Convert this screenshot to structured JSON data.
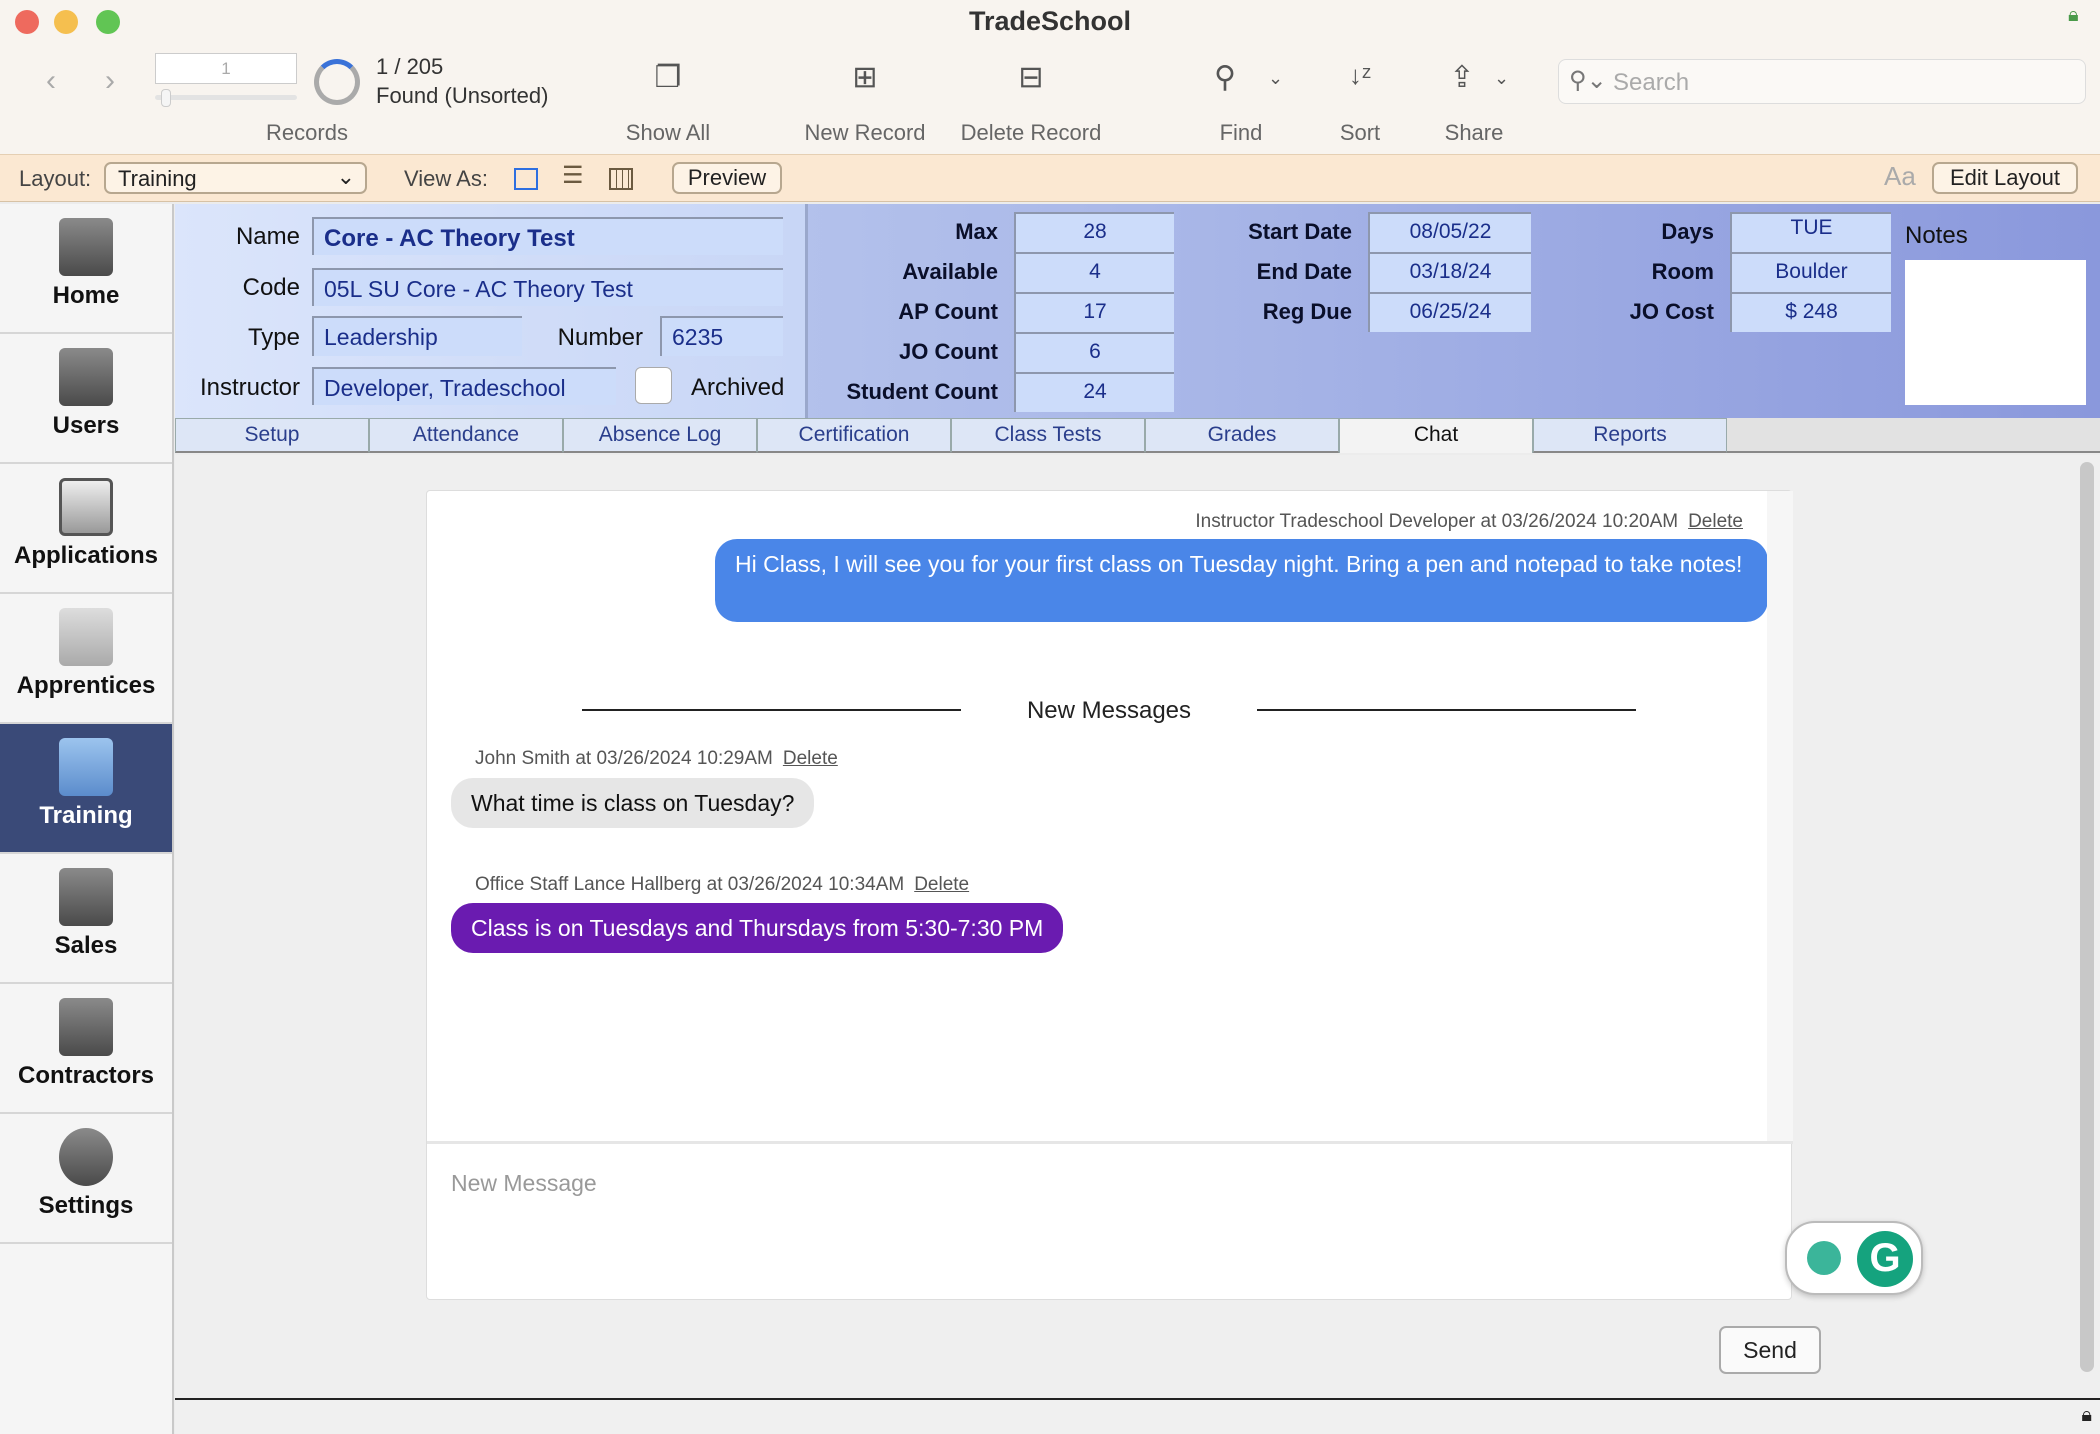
{
  "window": {
    "title": "TradeSchool"
  },
  "toolbar": {
    "record_number": "1",
    "record_count": "1 / 205",
    "found_status": "Found (Unsorted)",
    "records_label": "Records",
    "show_all": "Show All",
    "new_record": "New Record",
    "delete_record": "Delete Record",
    "find": "Find",
    "sort": "Sort",
    "share": "Share",
    "search_placeholder": "Search",
    "progress_fraction": 0.005
  },
  "layoutbar": {
    "layout_label": "Layout:",
    "layout_value": "Training",
    "view_as_label": "View As:",
    "preview": "Preview",
    "edit_layout": "Edit Layout",
    "text_size_icon": "Aa"
  },
  "sidebar": {
    "items": [
      {
        "label": "Home",
        "icon": "house-icon"
      },
      {
        "label": "Users",
        "icon": "address-book-icon"
      },
      {
        "label": "Applications",
        "icon": "clipboard-icon"
      },
      {
        "label": "Apprentices",
        "icon": "id-card-icon"
      },
      {
        "label": "Training",
        "icon": "certificate-icon",
        "active": true
      },
      {
        "label": "Sales",
        "icon": "basket-icon"
      },
      {
        "label": "Contractors",
        "icon": "briefcase-icon"
      },
      {
        "label": "Settings",
        "icon": "wrench-icon"
      }
    ]
  },
  "record": {
    "name_label": "Name",
    "name": "Core - AC Theory Test",
    "code_label": "Code",
    "code": "05L SU Core - AC Theory Test",
    "type_label": "Type",
    "type": "Leadership",
    "number_label": "Number",
    "number": "6235",
    "instructor_label": "Instructor",
    "instructor": "Developer, Tradeschool",
    "archived_label": "Archived",
    "max_label": "Max",
    "max": "28",
    "available_label": "Available",
    "available": "4",
    "ap_count_label": "AP Count",
    "ap_count": "17",
    "jo_count_label": "JO Count",
    "jo_count": "6",
    "student_count_label": "Student Count",
    "student_count": "24",
    "start_date_label": "Start Date",
    "start_date": "08/05/22",
    "end_date_label": "End Date",
    "end_date": "03/18/24",
    "reg_due_label": "Reg Due",
    "reg_due": "06/25/24",
    "days_label": "Days",
    "days": "TUE",
    "room_label": "Room",
    "room": "Boulder",
    "jo_cost_label": "JO Cost",
    "jo_cost": "$ 248",
    "notes_label": "Notes"
  },
  "tabs": [
    "Setup",
    "Attendance",
    "Absence Log",
    "Certification",
    "Class Tests",
    "Grades",
    "Chat",
    "Reports"
  ],
  "chat": {
    "messages": [
      {
        "meta": "Instructor Tradeschool Developer at 03/26/2024 10:20AM",
        "delete": "Delete",
        "text": "Hi Class, I will see you for your first class on Tuesday night. Bring a pen and notepad to take notes!",
        "color": "#4a86e8"
      },
      {
        "meta": "John Smith at 03/26/2024 10:29AM",
        "delete": "Delete",
        "text": "What time is class on Tuesday?",
        "color": "#e6e6e6"
      },
      {
        "meta": "Office Staff Lance Hallberg at 03/26/2024 10:34AM",
        "delete": "Delete",
        "text": "Class is on Tuesdays and Thursdays from 5:30-7:30 PM",
        "color": "#6a1bb0"
      }
    ],
    "divider": "New Messages",
    "input_placeholder": "New Message",
    "send": "Send"
  }
}
